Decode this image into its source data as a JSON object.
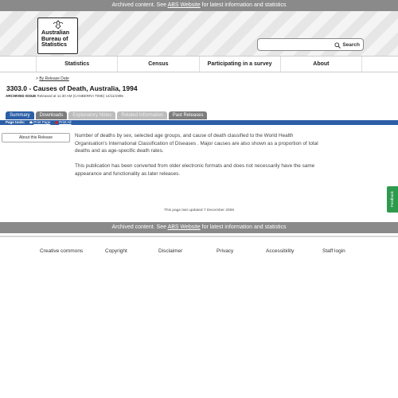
{
  "archive_bar": {
    "prefix": "Archived content. See ",
    "link": "ABS Website",
    "suffix": " for latest information and statistics"
  },
  "logo": {
    "line1": "Australian",
    "line2": "Bureau of",
    "line3": "Statistics"
  },
  "search": {
    "placeholder": "",
    "button_label": "Search"
  },
  "nav": {
    "items": [
      "Statistics",
      "Census",
      "Participating in a survey",
      "About"
    ]
  },
  "breadcrumb": {
    "prefix": "> ",
    "link": "By Release Date"
  },
  "page": {
    "title": "3303.0 - Causes of Death, Australia, 1994",
    "archived_label": "ARCHIVED ISSUE",
    "archived_text": " Released at 11:30 AM (CANBERRA TIME) 14/11/1995"
  },
  "tabs": [
    {
      "label": "Summary",
      "state": "active"
    },
    {
      "label": "Downloads",
      "state": "normal"
    },
    {
      "label": "Explanatory Notes",
      "state": "disabled"
    },
    {
      "label": "Related Information",
      "state": "disabled"
    },
    {
      "label": "Past Releases",
      "state": "normal"
    }
  ],
  "tools": {
    "label": "Page tools:",
    "print_page": "Print Page",
    "print_all": "Print All"
  },
  "side": {
    "about_button": "About this Release"
  },
  "content": {
    "para1": "Number of deaths by sex, selected age groups, and cause of death classified to the World Health Organisation's International Classification of Diseases . Major causes are also shown as a proportion of total deaths and as age-specific death rates.",
    "para2": "This publication has been converted from older electronic formats and does not necessarily have the same appearance and functionality as later releases."
  },
  "updated": "This page last updated 7 December 2006",
  "footer_bar": {
    "prefix": "Archived content. See ",
    "link": "ABS Website",
    "suffix": " for latest information and statistics"
  },
  "footer_links": [
    "Creative commons",
    "Copyright",
    "Disclaimer",
    "Privacy",
    "Accessibility",
    "Staff login"
  ],
  "feedback": "Feedback",
  "colors": {
    "primary": "#2b5ea6",
    "archive_bar": "#8a8a8a",
    "feedback": "#2e9a4e"
  }
}
